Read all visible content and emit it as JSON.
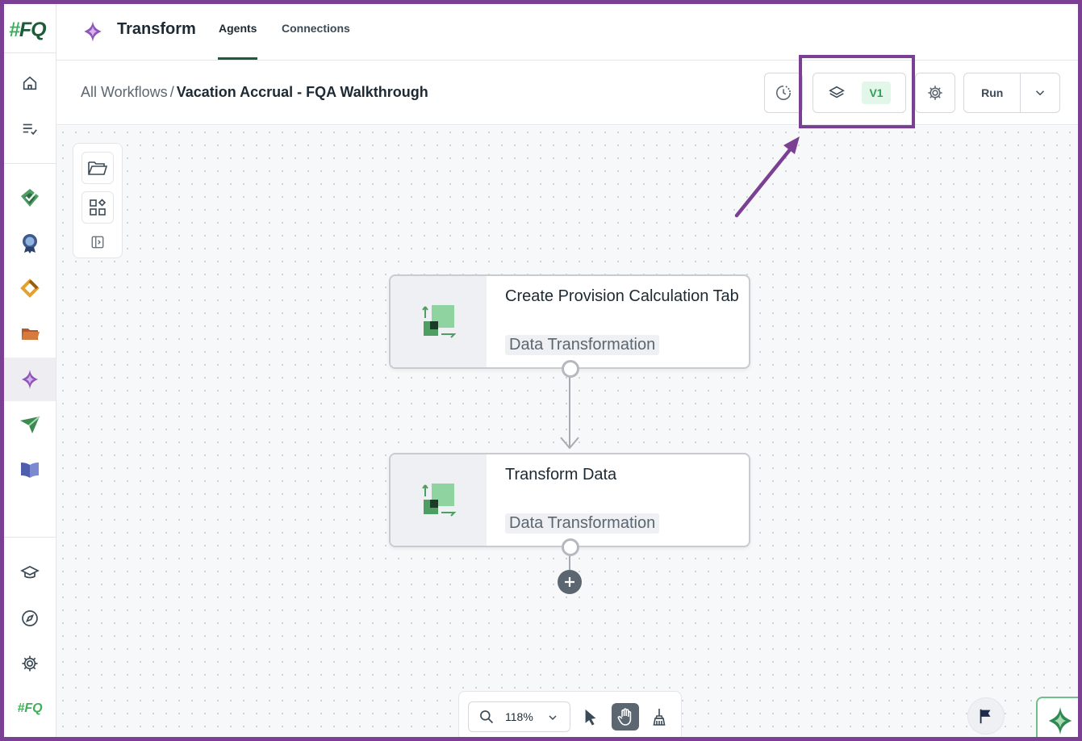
{
  "brand": {
    "logo_hash": "#",
    "logo_text": "FQ"
  },
  "header": {
    "title": "Transform",
    "tabs": [
      {
        "label": "Agents"
      },
      {
        "label": "Connections"
      }
    ]
  },
  "breadcrumb": {
    "parent": "All Workflows",
    "separator": "/",
    "current": "Vacation Accrual - FQA Walkthrough"
  },
  "toolbar": {
    "version_label": "V1",
    "run_label": "Run"
  },
  "nodes": [
    {
      "title": "Create Provision Calculation Tab",
      "tag": "Data Transformation"
    },
    {
      "title": "Transform Data",
      "tag": "Data Transformation"
    }
  ],
  "zoom": {
    "value": "118%"
  },
  "rail_footer_logo": "#FQ",
  "icons": {
    "rail": [
      "home-icon",
      "task-list-icon",
      "checklist-icon",
      "certificate-icon",
      "link-icon",
      "folder-icon",
      "sparkle-icon",
      "send-icon",
      "book-icon",
      "academy-icon",
      "compass-icon",
      "gear-icon",
      "fq-icon"
    ],
    "toolbar": [
      "history-icon",
      "layers-icon",
      "gear-icon",
      "chevron-down-icon"
    ],
    "canvas_tools": [
      "folder-open-icon",
      "shapes-icon",
      "panel-toggle-icon"
    ],
    "zoom_tools": [
      "search-icon",
      "chevron-down-icon",
      "pointer-icon",
      "hand-icon",
      "broom-icon"
    ]
  },
  "colors": {
    "accent_purple": "#7b3f93",
    "brand_green": "#1e5b3a",
    "version_badge_bg": "#e3f6ea",
    "version_badge_text": "#2f9e57"
  }
}
